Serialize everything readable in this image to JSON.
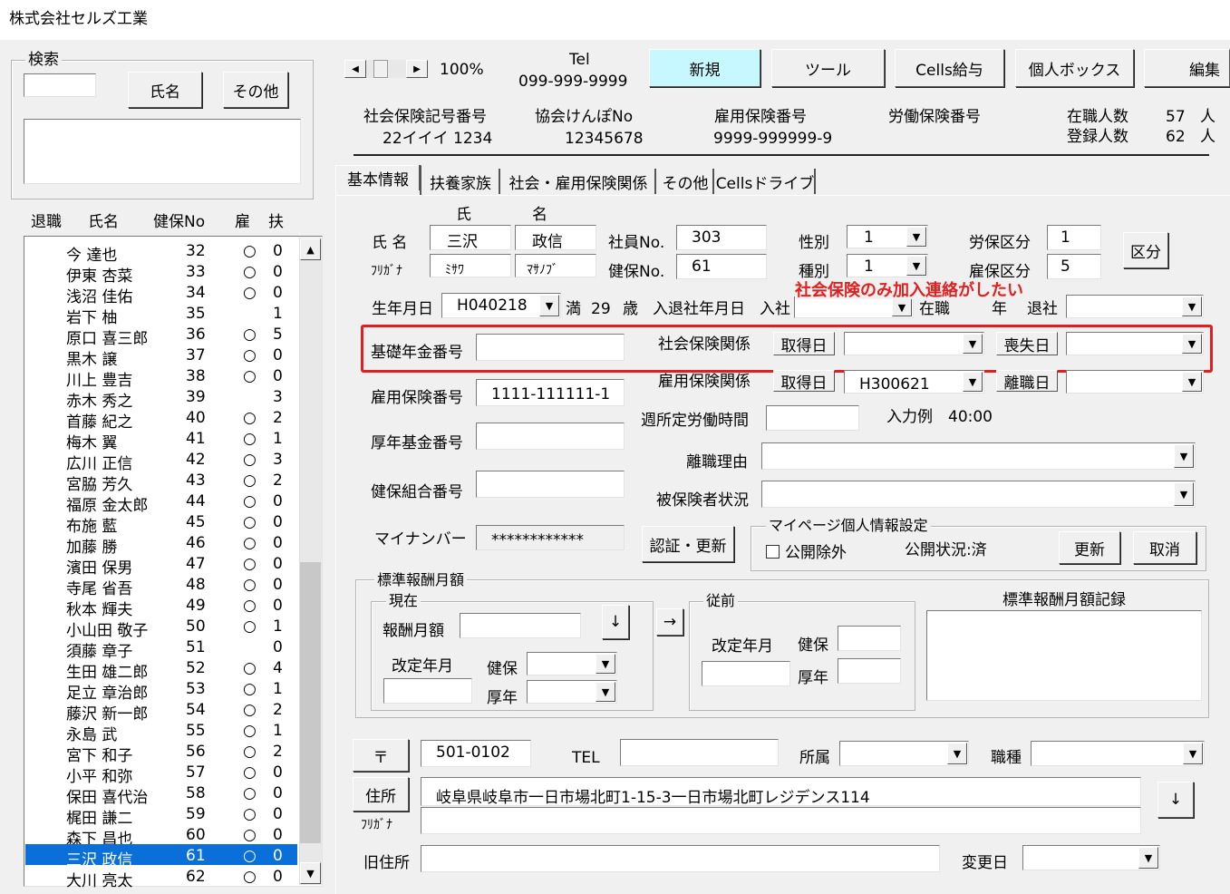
{
  "window": {
    "title": "株式会社セルズ工業"
  },
  "search": {
    "title": "検索",
    "name_button": "氏名",
    "other_button": "その他"
  },
  "list": {
    "headers": [
      "退職",
      "氏名",
      "健保No",
      "雇",
      "扶"
    ],
    "rows": [
      [
        "今 達也",
        "32",
        "○",
        "0"
      ],
      [
        "伊東 杏菜",
        "33",
        "○",
        "0"
      ],
      [
        "浅沼 佳佑",
        "34",
        "○",
        "0"
      ],
      [
        "岩下 柚",
        "35",
        "",
        "1"
      ],
      [
        "原口 喜三郎",
        "36",
        "○",
        "5"
      ],
      [
        "黒木 譲",
        "37",
        "○",
        "0"
      ],
      [
        "川上 豊吉",
        "38",
        "○",
        "0"
      ],
      [
        "赤木 秀之",
        "39",
        "",
        "3"
      ],
      [
        "首藤 紀之",
        "40",
        "○",
        "2"
      ],
      [
        "梅木 翼",
        "41",
        "○",
        "1"
      ],
      [
        "広川 正信",
        "42",
        "○",
        "3"
      ],
      [
        "宮脇 芳久",
        "43",
        "○",
        "2"
      ],
      [
        "福原 金太郎",
        "44",
        "○",
        "0"
      ],
      [
        "布施 藍",
        "45",
        "○",
        "0"
      ],
      [
        "加藤 勝",
        "46",
        "○",
        "0"
      ],
      [
        "濱田 保男",
        "47",
        "○",
        "0"
      ],
      [
        "寺尾 省吾",
        "48",
        "○",
        "0"
      ],
      [
        "秋本 輝夫",
        "49",
        "○",
        "0"
      ],
      [
        "小山田 敬子",
        "50",
        "○",
        "1"
      ],
      [
        "須藤 章子",
        "51",
        "",
        "0"
      ],
      [
        "生田 雄二郎",
        "52",
        "○",
        "4"
      ],
      [
        "足立 章治郎",
        "53",
        "○",
        "1"
      ],
      [
        "藤沢 新一郎",
        "54",
        "○",
        "2"
      ],
      [
        "永島 武",
        "55",
        "○",
        "1"
      ],
      [
        "宮下 和子",
        "56",
        "○",
        "2"
      ],
      [
        "小平 和弥",
        "57",
        "○",
        "0"
      ],
      [
        "保田 喜代治",
        "58",
        "○",
        "0"
      ],
      [
        "梶田 謙二",
        "59",
        "○",
        "0"
      ],
      [
        "森下 昌也",
        "60",
        "○",
        "0"
      ],
      [
        "三沢 政信",
        "61",
        "○",
        "0"
      ],
      [
        "大川 亮太",
        "62",
        "○",
        "0"
      ]
    ],
    "selected_index": 29
  },
  "toolbar": {
    "zoom": "100%",
    "tel_label": "Tel",
    "tel": "099-999-9999",
    "buttons": [
      "新規",
      "ツール",
      "Cells給与",
      "個人ボックス",
      "編集"
    ]
  },
  "company": {
    "shakai_label": "社会保険記号番号",
    "shakai_value": "22イイイ 1234",
    "kyokai_label": "協会けんぽNo",
    "kyokai_value": "12345678",
    "koyo_label": "雇用保険番号",
    "koyo_value": "9999-999999-9",
    "rodo_label": "労働保険番号",
    "zaishoku_label": "在職人数",
    "zaishoku_value": "57",
    "toroku_label": "登録人数",
    "toroku_value": "62",
    "unit": "人"
  },
  "tabs": [
    "基本情報",
    "扶養家族",
    "社会・雇用保険関係",
    "その他",
    "Cellsドライブ"
  ],
  "basic": {
    "shi_head": "氏",
    "mei_head": "名",
    "name_label": "氏 名",
    "sei": "三沢",
    "mei": "政信",
    "furigana_label": "ﾌﾘｶﾞﾅ",
    "sei_kana": "ﾐｻﾜ",
    "mei_kana": "ﾏｻﾉﾌﾞ",
    "shain_label": "社員No.",
    "shain_no": "303",
    "kenpo_label": "健保No.",
    "kenpo_no": "61",
    "seibetsu_label": "性別",
    "seibetsu": "1",
    "shubetsu_label": "種別",
    "shubetsu": "1",
    "roho_label": "労保区分",
    "roho": "1",
    "koho_label": "雇保区分",
    "koho": "5",
    "kubun_button": "区分",
    "birth_label": "生年月日",
    "birth": "H040218",
    "man": "満",
    "age": "29",
    "sai": "歳",
    "nyutai_label": "入退社年月日",
    "nyusha": "入社",
    "zaishoku": "在職",
    "nen": "年",
    "taisha": "退社",
    "annotation": "社会保険のみ加入連絡がしたい"
  },
  "pension": {
    "kiso_label": "基礎年金番号",
    "shaho_label": "社会保険関係",
    "get_button": "取得日",
    "lose_button": "喪失日",
    "koyo_label": "雇用保険番号",
    "koyo_no": "1111-111111-1",
    "koyo_kankei_label": "雇用保険関係",
    "koyo_get": "H300621",
    "rishoku_button": "離職日",
    "shuu_label": "週所定労働時間",
    "example": "入力例　40:00",
    "kosei_label": "厚年基金番号",
    "rishoku_reason": "離職理由",
    "kenpo_kumiai": "健保組合番号",
    "hihoken": "被保険者状況",
    "mynumber_label": "マイナンバー",
    "mynumber": "************",
    "auth_button": "認証・更新"
  },
  "mypage": {
    "title": "マイページ個人情報設定",
    "exclude": "公開除外",
    "status": "公開状況:済",
    "update": "更新",
    "cancel": "取消"
  },
  "hyojun": {
    "title": "標準報酬月額",
    "current": "現在",
    "hoshu": "報酬月額",
    "kaitei": "改定年月",
    "kenpo": "健保",
    "kosei": "厚年",
    "previous": "従前",
    "record": "標準報酬月額記録",
    "down": "↓",
    "right": "→"
  },
  "address": {
    "zip_button": "〒",
    "zip": "501-0102",
    "tel_label": "TEL",
    "shozoku": "所属",
    "shokushu": "職種",
    "address_button": "住所",
    "address": "岐阜県岐阜市一日市場北町1-15-3一日市場北町レジデンス114",
    "furigana": "ﾌﾘｶﾞﾅ",
    "down": "↓",
    "old_label": "旧住所",
    "change_label": "変更日"
  },
  "colors": {
    "selection": "#0a6fd8",
    "annotation": "#e02020",
    "new_button": "#c8f8ff"
  }
}
